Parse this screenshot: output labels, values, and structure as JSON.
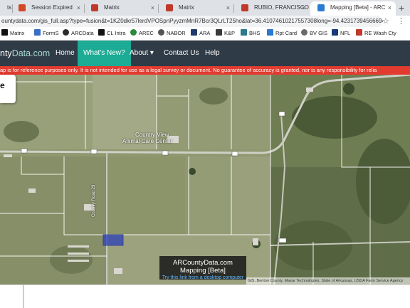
{
  "browser": {
    "tabs": [
      {
        "title": "ts",
        "favicon_color": "#4a6fa5",
        "active": false
      },
      {
        "title": "Session Expired",
        "favicon_color": "#d24726",
        "active": false
      },
      {
        "title": "Matrix",
        "favicon_color": "#c0392b",
        "active": false
      },
      {
        "title": "Matrix",
        "favicon_color": "#c0392b",
        "active": false
      },
      {
        "title": "RUBIO, FRANCISCO JAV",
        "favicon_color": "#c0392b",
        "active": false
      },
      {
        "title": "Mapping [Beta] - ARC",
        "favicon_color": "#2b7bd0",
        "active": true
      }
    ],
    "close_glyph": "×",
    "url": "ountydata.com/gis_full.asp?type=fusion&t=1KZ0dkr57lerdVPOSpnPyyzmMnR7Bcr3QLrLT25ho&lat=36.41074610217557308long=-94.42317394566694...",
    "bookmarks": [
      {
        "label": "Matrix",
        "icon_color": "#111"
      },
      {
        "label": "FormS",
        "icon_color": "#3a6fc4"
      },
      {
        "label": "ARCData",
        "icon_color": "#2b2b2b"
      },
      {
        "label": "CL Intra",
        "icon_color": "#111"
      },
      {
        "label": "AREC",
        "icon_color": "#2a8a3a"
      },
      {
        "label": "NABOR",
        "icon_color": "#555"
      },
      {
        "label": "ARA",
        "icon_color": "#1f3b6b"
      },
      {
        "label": "K&P",
        "icon_color": "#3a3a3a"
      },
      {
        "label": "BHS",
        "icon_color": "#2a7a8a"
      },
      {
        "label": "Rpt Card",
        "icon_color": "#2b78d0"
      },
      {
        "label": "BV GIS",
        "icon_color": "#6a6a6a"
      },
      {
        "label": "NFL",
        "icon_color": "#1a3a7a"
      },
      {
        "label": "RE Wash Cty",
        "icon_color": "#c0392b"
      }
    ]
  },
  "site": {
    "brand_dark": "nty",
    "brand_light": "Data.com",
    "nav": [
      {
        "label": "Home",
        "active": false
      },
      {
        "label": "What's New?",
        "active": true
      },
      {
        "label": "About ▾",
        "active": false
      },
      {
        "label": "Contact Us",
        "active": false
      },
      {
        "label": "Help",
        "active": false
      }
    ],
    "warning": "ap is for reference purposes only. It is not intended for use as a legal survey or document. No guarantee of accuracy is granted, nor is any responsibility for relia",
    "panel_toggle": "e"
  },
  "map": {
    "labels": [
      {
        "text": "Country View",
        "id": "country-view"
      },
      {
        "text": "Animal Care Center",
        "id": "animal-care"
      },
      {
        "text": "Country Road 29",
        "id": "road-29"
      }
    ],
    "caption_title": "ARCountyData.com Mapping [Beta]",
    "caption_link": "Try this link from a desktop computer",
    "attribution": "GIS, Benton County, Maxar Technologies, State of Arkansas, USDA Farm Service Agency"
  }
}
